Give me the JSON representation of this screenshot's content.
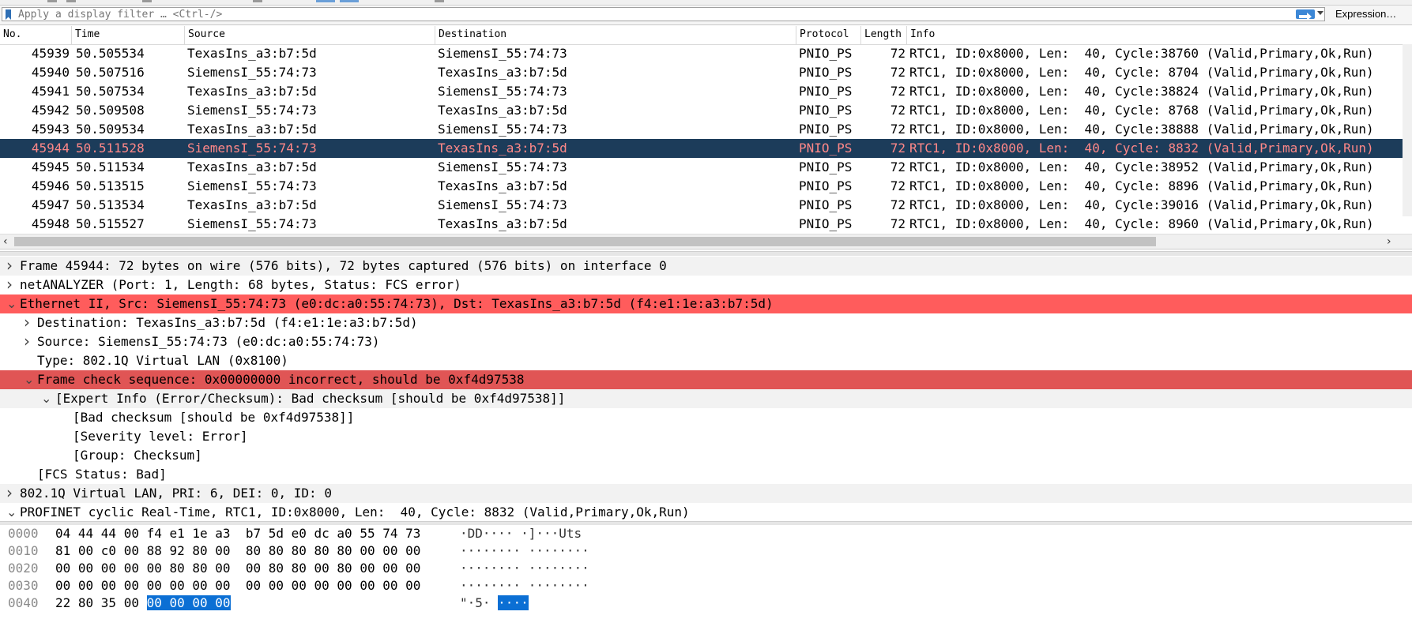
{
  "filter": {
    "placeholder": "Apply a display filter … <Ctrl-/>",
    "expression_label": "Expression…",
    "bookmark_icon": "bookmark-icon",
    "apply_icon": "arrow-right-icon"
  },
  "packet_list": {
    "columns": [
      "No.",
      "Time",
      "Source",
      "Destination",
      "Protocol",
      "Length",
      "Info"
    ],
    "rows": [
      {
        "no": "45939",
        "time": "50.505534",
        "src": "TexasIns_a3:b7:5d",
        "dst": "SiemensI_55:74:73",
        "proto": "PNIO_PS",
        "len": "72",
        "info": "RTC1, ID:0x8000, Len:  40, Cycle:38760 (Valid,Primary,Ok,Run)"
      },
      {
        "no": "45940",
        "time": "50.507516",
        "src": "SiemensI_55:74:73",
        "dst": "TexasIns_a3:b7:5d",
        "proto": "PNIO_PS",
        "len": "72",
        "info": "RTC1, ID:0x8000, Len:  40, Cycle: 8704 (Valid,Primary,Ok,Run)"
      },
      {
        "no": "45941",
        "time": "50.507534",
        "src": "TexasIns_a3:b7:5d",
        "dst": "SiemensI_55:74:73",
        "proto": "PNIO_PS",
        "len": "72",
        "info": "RTC1, ID:0x8000, Len:  40, Cycle:38824 (Valid,Primary,Ok,Run)"
      },
      {
        "no": "45942",
        "time": "50.509508",
        "src": "SiemensI_55:74:73",
        "dst": "TexasIns_a3:b7:5d",
        "proto": "PNIO_PS",
        "len": "72",
        "info": "RTC1, ID:0x8000, Len:  40, Cycle: 8768 (Valid,Primary,Ok,Run)"
      },
      {
        "no": "45943",
        "time": "50.509534",
        "src": "TexasIns_a3:b7:5d",
        "dst": "SiemensI_55:74:73",
        "proto": "PNIO_PS",
        "len": "72",
        "info": "RTC1, ID:0x8000, Len:  40, Cycle:38888 (Valid,Primary,Ok,Run)"
      },
      {
        "no": "45944",
        "time": "50.511528",
        "src": "SiemensI_55:74:73",
        "dst": "TexasIns_a3:b7:5d",
        "proto": "PNIO_PS",
        "len": "72",
        "info": "RTC1, ID:0x8000, Len:  40, Cycle: 8832 (Valid,Primary,Ok,Run)"
      },
      {
        "no": "45945",
        "time": "50.511534",
        "src": "TexasIns_a3:b7:5d",
        "dst": "SiemensI_55:74:73",
        "proto": "PNIO_PS",
        "len": "72",
        "info": "RTC1, ID:0x8000, Len:  40, Cycle:38952 (Valid,Primary,Ok,Run)"
      },
      {
        "no": "45946",
        "time": "50.513515",
        "src": "SiemensI_55:74:73",
        "dst": "TexasIns_a3:b7:5d",
        "proto": "PNIO_PS",
        "len": "72",
        "info": "RTC1, ID:0x8000, Len:  40, Cycle: 8896 (Valid,Primary,Ok,Run)"
      },
      {
        "no": "45947",
        "time": "50.513534",
        "src": "TexasIns_a3:b7:5d",
        "dst": "SiemensI_55:74:73",
        "proto": "PNIO_PS",
        "len": "72",
        "info": "RTC1, ID:0x8000, Len:  40, Cycle:39016 (Valid,Primary,Ok,Run)"
      },
      {
        "no": "45948",
        "time": "50.515527",
        "src": "SiemensI_55:74:73",
        "dst": "TexasIns_a3:b7:5d",
        "proto": "PNIO_PS",
        "len": "72",
        "info": "RTC1, ID:0x8000, Len:  40, Cycle: 8960 (Valid,Primary,Ok,Run)"
      }
    ],
    "selected_index": 5
  },
  "details": [
    {
      "level": 0,
      "toggle": "collapsed",
      "style": "alt",
      "text": "Frame 45944: 72 bytes on wire (576 bits), 72 bytes captured (576 bits) on interface 0"
    },
    {
      "level": 0,
      "toggle": "collapsed",
      "style": "",
      "text": "netANALYZER (Port: 1, Length: 68 bytes, Status: FCS error)"
    },
    {
      "level": 0,
      "toggle": "expanded",
      "style": "err-red",
      "text": "Ethernet II, Src: SiemensI_55:74:73 (e0:dc:a0:55:74:73), Dst: TexasIns_a3:b7:5d (f4:e1:1e:a3:b7:5d)"
    },
    {
      "level": 1,
      "toggle": "collapsed",
      "style": "",
      "text": "Destination: TexasIns_a3:b7:5d (f4:e1:1e:a3:b7:5d)"
    },
    {
      "level": 1,
      "toggle": "collapsed",
      "style": "",
      "text": "Source: SiemensI_55:74:73 (e0:dc:a0:55:74:73)"
    },
    {
      "level": 1,
      "toggle": "none",
      "style": "",
      "text": "Type: 802.1Q Virtual LAN (0x8100)"
    },
    {
      "level": 1,
      "toggle": "expanded",
      "style": "err-dark",
      "text": "Frame check sequence: 0x00000000 incorrect, should be 0xf4d97538"
    },
    {
      "level": 2,
      "toggle": "expanded",
      "style": "alt",
      "text": "[Expert Info (Error/Checksum): Bad checksum [should be 0xf4d97538]]"
    },
    {
      "level": 3,
      "toggle": "none",
      "style": "",
      "text": "[Bad checksum [should be 0xf4d97538]]"
    },
    {
      "level": 3,
      "toggle": "none",
      "style": "",
      "text": "[Severity level: Error]"
    },
    {
      "level": 3,
      "toggle": "none",
      "style": "",
      "text": "[Group: Checksum]"
    },
    {
      "level": 1,
      "toggle": "none",
      "style": "",
      "text": "[FCS Status: Bad]"
    },
    {
      "level": 0,
      "toggle": "collapsed",
      "style": "alt",
      "text": "802.1Q Virtual LAN, PRI: 6, DEI: 0, ID: 0"
    },
    {
      "level": 0,
      "toggle": "expanded",
      "style": "",
      "text": "PROFINET cyclic Real-Time, RTC1, ID:0x8000, Len:  40, Cycle: 8832 (Valid,Primary,Ok,Run)"
    }
  ],
  "hex": [
    {
      "offset": "0000",
      "bytes": "04 44 44 00 f4 e1 1e a3  b7 5d e0 dc a0 55 74 73",
      "ascii": "·DD···· ·]···Uts"
    },
    {
      "offset": "0010",
      "bytes": "81 00 c0 00 88 92 80 00  80 80 80 80 80 00 00 00",
      "ascii": "········ ········"
    },
    {
      "offset": "0020",
      "bytes": "00 00 00 00 00 80 80 00  00 80 80 00 80 00 00 00",
      "ascii": "········ ········"
    },
    {
      "offset": "0030",
      "bytes": "00 00 00 00 00 00 00 00  00 00 00 00 00 00 00 00",
      "ascii": "········ ········"
    },
    {
      "offset": "0040",
      "bytes_plain": "22 80 35 00 ",
      "bytes_hl": "00 00 00 00",
      "ascii_plain": "\"·5·",
      "ascii_hl": "····"
    }
  ],
  "colors": {
    "selected_bg": "#1c3c5a",
    "selected_fg": "#ff8888",
    "error_bg": "#ff5c5c",
    "error_dark_bg": "#e05555",
    "hex_highlight": "#0b6fd4"
  }
}
